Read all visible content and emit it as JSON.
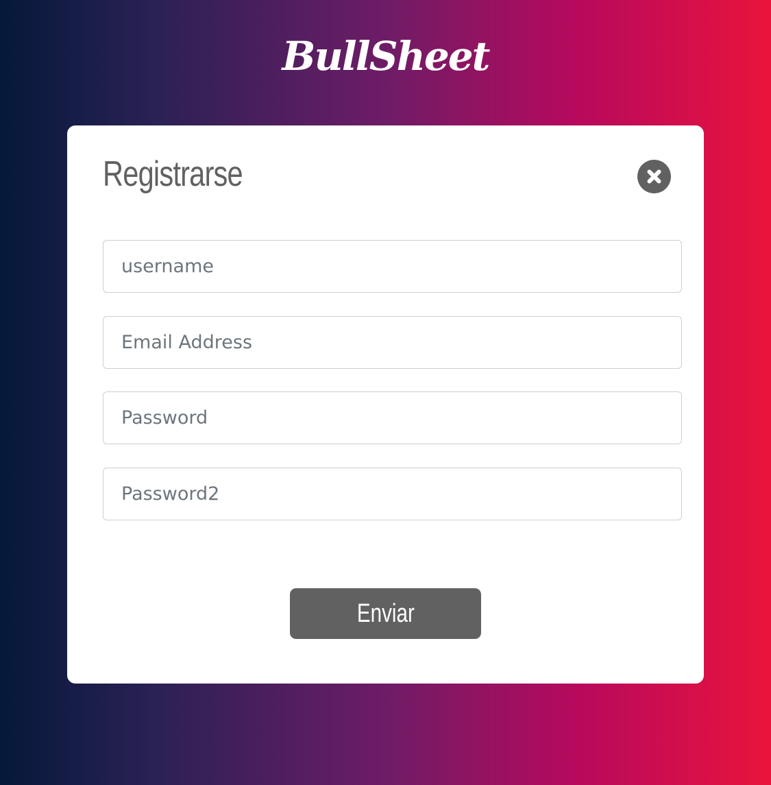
{
  "brand": {
    "logo_text": "BullSheet"
  },
  "modal": {
    "title": "Registrarse",
    "close_icon": "close-circle-icon"
  },
  "form": {
    "username": {
      "value": "",
      "placeholder": "username"
    },
    "email": {
      "value": "",
      "placeholder": "Email Address"
    },
    "password": {
      "value": "",
      "placeholder": "Password"
    },
    "password2": {
      "value": "",
      "placeholder": "Password2"
    },
    "submit_label": "Enviar"
  },
  "colors": {
    "gradient_start": "#05193a",
    "gradient_end": "#e9143c",
    "panel_background": "#ffffff",
    "accent_gray": "#616161"
  }
}
